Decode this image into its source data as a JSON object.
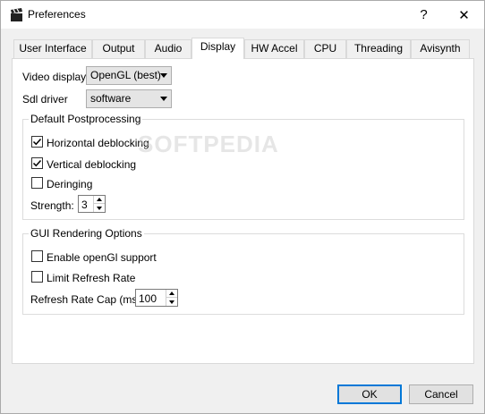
{
  "window": {
    "title": "Preferences",
    "help_label": "?",
    "close_label": "✕"
  },
  "tabs": [
    {
      "label": "User Interface"
    },
    {
      "label": "Output"
    },
    {
      "label": "Audio"
    },
    {
      "label": "Display",
      "active": true
    },
    {
      "label": "HW Accel"
    },
    {
      "label": "CPU"
    },
    {
      "label": "Threading"
    },
    {
      "label": "Avisynth"
    }
  ],
  "display": {
    "video_display_label": "Video display:",
    "video_display_value": "OpenGL (best)",
    "sdl_driver_label": "Sdl driver",
    "sdl_driver_value": "software",
    "postprocessing": {
      "title": "Default Postprocessing",
      "horizontal_label": "Horizontal deblocking",
      "horizontal_checked": true,
      "vertical_label": "Vertical deblocking",
      "vertical_checked": true,
      "deringing_label": "Deringing",
      "deringing_checked": false,
      "strength_label": "Strength:",
      "strength_value": "3"
    },
    "gui_rendering": {
      "title": "GUI Rendering Options",
      "opengl_label": "Enable openGl support",
      "opengl_checked": false,
      "limit_label": "Limit Refresh Rate",
      "limit_checked": false,
      "cap_label": "Refresh Rate Cap (ms)",
      "cap_value": "100"
    }
  },
  "buttons": {
    "ok_label": "OK",
    "cancel_label": "Cancel"
  },
  "watermark": "SOFTPEDIA",
  "colors": {
    "accent": "#0078d7",
    "panel_bg": "#ffffff",
    "window_bg": "#f0f0f0"
  }
}
